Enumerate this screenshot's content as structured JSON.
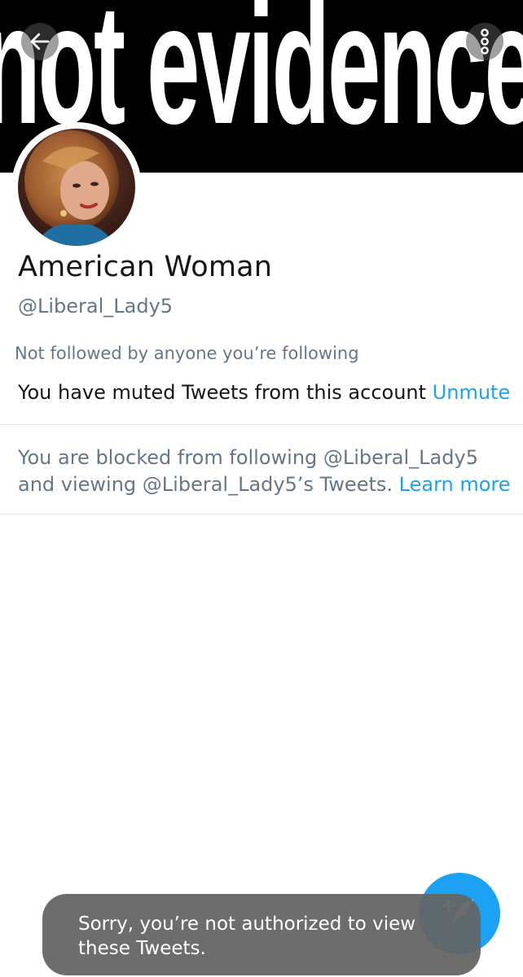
{
  "header": {
    "banner_text": "not evidence",
    "back_icon": "arrow-left-icon",
    "more_icon": "more-vertical-icon"
  },
  "profile": {
    "name": "American Woman",
    "handle": "@Liberal_Lady5",
    "not_followed": "Not followed by anyone you’re following",
    "muted_text": "You have muted Tweets from this account",
    "unmute_label": "Unmute"
  },
  "blocked": {
    "text": "You are blocked from following @Liberal_Lady5 and viewing @Liberal_Lady5’s Tweets.",
    "learn_more_label": "Learn more"
  },
  "fab": {
    "icon": "compose-tweet-icon"
  },
  "toast": {
    "message": "Sorry, you’re not authorized to view these Tweets."
  },
  "colors": {
    "accent": "#1da1f2",
    "secondary_text": "#657786",
    "primary_text": "#14171a",
    "toast_bg": "#646464"
  }
}
